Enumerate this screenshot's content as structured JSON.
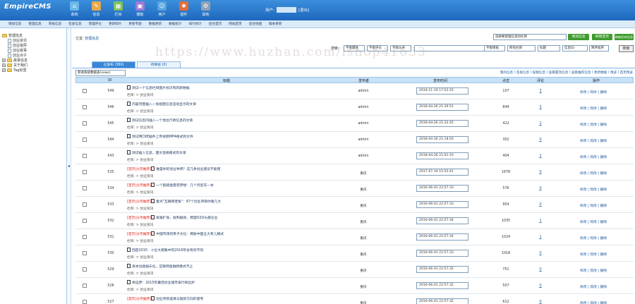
{
  "app": {
    "logo": "EmpireCMS",
    "user_label": "用户:",
    "logout": "[退出]"
  },
  "topnav": [
    {
      "label": "系统",
      "icon": "system-icon",
      "color": "#6bb7ea",
      "glyph": "⌂"
    },
    {
      "label": "信息",
      "icon": "info-icon",
      "color": "#e8a94a",
      "glyph": "✎"
    },
    {
      "label": "栏目",
      "icon": "column-icon",
      "color": "#7fc25c",
      "glyph": "▦"
    },
    {
      "label": "模板",
      "icon": "template-icon",
      "color": "#9c7ad6",
      "glyph": "▣"
    },
    {
      "label": "用户",
      "icon": "user-icon",
      "color": "#58a4dd",
      "glyph": "☺"
    },
    {
      "label": "插件",
      "icon": "plugin-icon",
      "color": "#e06d3c",
      "glyph": "✱"
    },
    {
      "label": "其他",
      "icon": "other-icon",
      "color": "#8ea2b8",
      "glyph": "⚙"
    }
  ],
  "subnav": [
    "增加信息",
    "管理信息",
    "审核信息",
    "签发信息",
    "管理评论",
    "更新碎片",
    "更新专题",
    "数据更新",
    "数据统计",
    "排行统计",
    "后台首页",
    "网站首页",
    "后台地图",
    "版本更新"
  ],
  "tree": [
    {
      "label": "管理信息",
      "kind": "root"
    },
    {
      "label": "创业资讯",
      "kind": "leaf"
    },
    {
      "label": "创业指导",
      "kind": "leaf"
    },
    {
      "label": "创业故事",
      "kind": "leaf"
    },
    {
      "label": "创业点子",
      "kind": "leaf"
    },
    {
      "label": "故事信息",
      "kind": "group"
    },
    {
      "label": "关于我们",
      "kind": "group"
    },
    {
      "label": "Tag标签",
      "kind": "group"
    }
  ],
  "location": {
    "label": "位置:",
    "link": "管理信息"
  },
  "toolbar": {
    "column_select": "选择要管理信息的栏目",
    "add": "增加信息",
    "refresh": "刷新首页",
    "refresh_all": "刷新所有信息页"
  },
  "search": {
    "label": "搜索:",
    "f1": "不限属性",
    "f2": "不限评论",
    "f3": "不限头条",
    "f4": "不限审核",
    "f5": "所有栏目",
    "f6": "标题",
    "f7": "信息ID",
    "f8": "降序排序",
    "f9": "全部时间",
    "btn": "搜索"
  },
  "tabs": {
    "published": "已发布 (380)",
    "pending": "待审核 (0)"
  },
  "table_select": "新闻系统数据表(news)",
  "quicklinks": [
    "我的信息",
    "签发信息",
    "投稿信息",
    "查看置顶信息",
    "查看推荐信息",
    "更新数据",
    "预览",
    "首页预览"
  ],
  "headers": {
    "id": "ID",
    "title": "标题",
    "publisher": "发布者",
    "time": "发布时间",
    "hits": "点击",
    "comments": "评论",
    "ops": "操作"
  },
  "ops": {
    "edit": "修改",
    "simple": "简改",
    "del": "删除"
  },
  "rows": [
    {
      "id": "549",
      "badge": "",
      "title": "测试一个信息栏目图片标识有的新数据",
      "cat": "栏目: > 创业资讯",
      "pub": "admin",
      "time": "2019-11-19 17:52:25",
      "hits": "107",
      "cmt": "3"
    },
    {
      "id": "546",
      "badge": "",
      "title": "内容页图插入一张视图信息自动显示的文章",
      "cat": "栏目: > 创业资讯",
      "pub": "admin",
      "time": "2018-04-26 21:39:51",
      "hits": "849",
      "cmt": "3"
    },
    {
      "id": "545",
      "badge": "",
      "title": "测试信息内插入一个地位行政信息的文章",
      "cat": "栏目: > 创业资讯",
      "pub": "admin",
      "time": "2018-04-26 21:32:45",
      "hits": "422",
      "cmt": "2"
    },
    {
      "id": "544",
      "badge": "",
      "title": "测试用CKE插件上传视频MP4格式的文件",
      "cat": "栏目: > 创业资讯",
      "pub": "admin",
      "time": "2018-04-26 21:18:03",
      "hits": "302",
      "cmt": "0"
    },
    {
      "id": "543",
      "badge": "",
      "title": "测试插入信息、图文混排模式的文章",
      "cat": "栏目: > 创业资讯",
      "pub": "admin",
      "time": "2018-04-26 21:01:10",
      "hits": "404",
      "cmt": "2"
    },
    {
      "id": "535",
      "badge": "[首页|分页推荐]",
      "title": "谁是你的创业导师？这几条创业建议不能错",
      "cat": "栏目: > 创业资讯",
      "pub": "重庆",
      "time": "2017-07-19 15:55:41",
      "hits": "1678",
      "cmt": "0"
    },
    {
      "id": "534",
      "badge": "[首页|分页推荐]",
      "title": "一个超级能量营梦想：几个月后写一本",
      "cat": "栏目: > 创业资讯",
      "pub": "重庆",
      "time": "2016-06-01 22:57:33",
      "hits": "576",
      "cmt": "0"
    },
    {
      "id": "533",
      "badge": "[首页|分页推荐]",
      "title": "盘点\"互联网老板\"：67个创业项目你看几大",
      "cat": "栏目: > 创业资讯",
      "pub": "重庆",
      "time": "2016-06-01 22:57:33",
      "hits": "954",
      "cmt": "0"
    },
    {
      "id": "532",
      "badge": "[首页|分页推荐]",
      "title": "病毒扩张、收购融资，梳理O2O头部企业",
      "cat": "栏目: > 创业资讯",
      "pub": "重庆",
      "time": "2016-06-01 22:57:34",
      "hits": "1035",
      "cmt": "1"
    },
    {
      "id": "531",
      "badge": "[首页|分页推荐]",
      "title": "中国市场的亲子文化：揭秘中国五大育儿模式",
      "cat": "栏目: > 创业资讯",
      "pub": "重庆",
      "time": "2016-06-01 22:57:34",
      "hits": "1024",
      "cmt": "1"
    },
    {
      "id": "530",
      "badge": "",
      "title": "回首2015：十位大佬眼中的2016年会有何不同",
      "cat": "栏目: > 创业资讯",
      "pub": "重庆",
      "time": "2016-06-01 22:57:33",
      "hits": "1018",
      "cmt": "0"
    },
    {
      "id": "529",
      "badge": "",
      "title": "资本也能娱乐化，互联网金融新模式不止",
      "cat": "栏目: > 创业资讯",
      "pub": "重庆",
      "time": "2016-06-01 22:57:32",
      "hits": "751",
      "cmt": "0"
    },
    {
      "id": "528",
      "badge": "",
      "title": "余运梦：2015年最佳创业城市排行榜出炉",
      "cat": "栏目: > 创业资讯",
      "pub": "重庆",
      "time": "2016-06-01 22:57:32",
      "hits": "507",
      "cmt": "0"
    },
    {
      "id": "527",
      "badge": "[首页|分页推荐]",
      "title": "创业项目选择与融资方向的思考",
      "cat": "栏目: > 创业资讯",
      "pub": "重庆",
      "time": "2016-06-01 22:57:32",
      "hits": "612",
      "cmt": "0"
    }
  ],
  "watermark": "https://www.huzhan.com/ishop41633",
  "colors": {
    "header": "#2a7acb",
    "btn_green": "#3f9b2c",
    "tab_active": "#3a86d6",
    "badge": "#e0261b"
  }
}
